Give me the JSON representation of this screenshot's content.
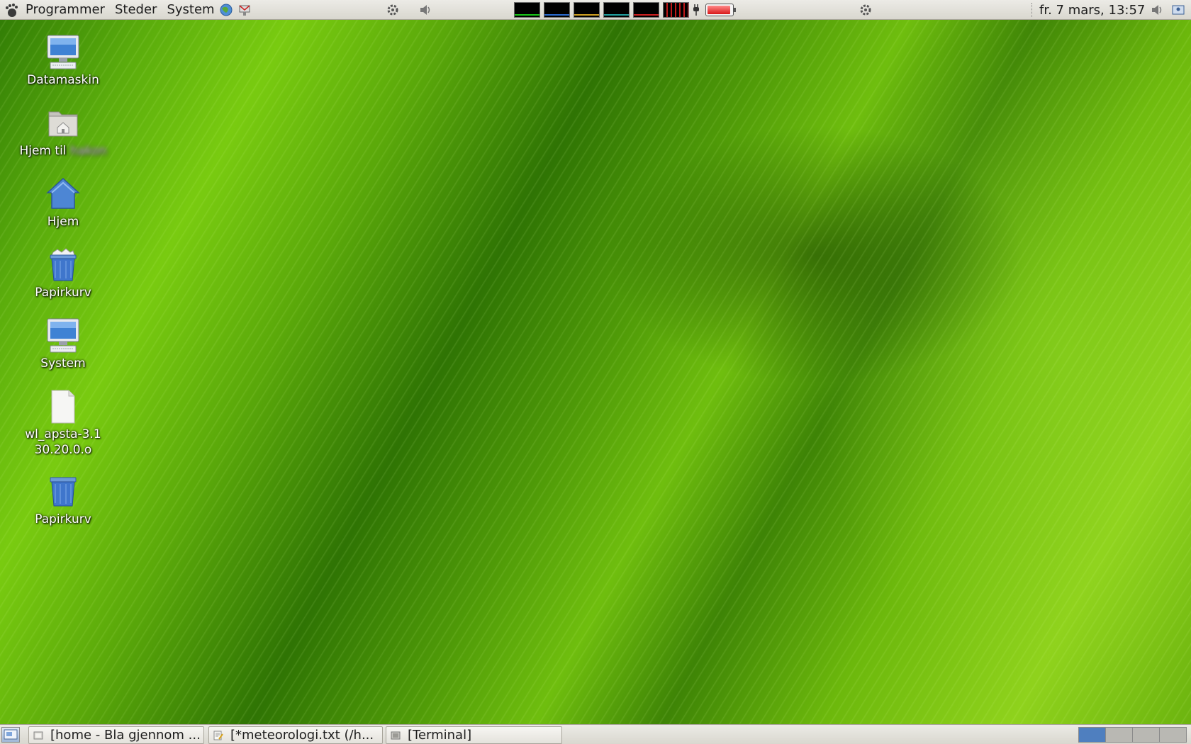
{
  "top_panel": {
    "menus": [
      "Programmer",
      "Steder",
      "System"
    ],
    "clock": "fr.  7 mars, 13:57"
  },
  "desktop": {
    "icons": [
      {
        "label": "Datamaskin",
        "icon": "computer-icon"
      },
      {
        "label": "Hjem til",
        "label_blurred": "hakon",
        "icon": "home-folder-icon"
      },
      {
        "label": "Hjem",
        "icon": "home-icon"
      },
      {
        "label": "Papirkurv",
        "icon": "trash-full-icon"
      },
      {
        "label": "System",
        "icon": "computer-icon"
      },
      {
        "label": "wl_apsta-3.130.20.0.o",
        "icon": "file-icon"
      },
      {
        "label": "Papirkurv",
        "icon": "trash-icon"
      }
    ]
  },
  "taskbar": {
    "tasks": [
      {
        "label": "[home - Bla gjennom ...",
        "icon": "folder-icon"
      },
      {
        "label": "[*meteorologi.txt (/h...",
        "icon": "text-editor-icon"
      },
      {
        "label": "[Terminal]",
        "icon": "terminal-icon"
      }
    ],
    "workspaces": 4,
    "active_workspace": 1
  },
  "colors": {
    "panel": "#e3e1db",
    "workspace_active": "#4f7fbf"
  }
}
